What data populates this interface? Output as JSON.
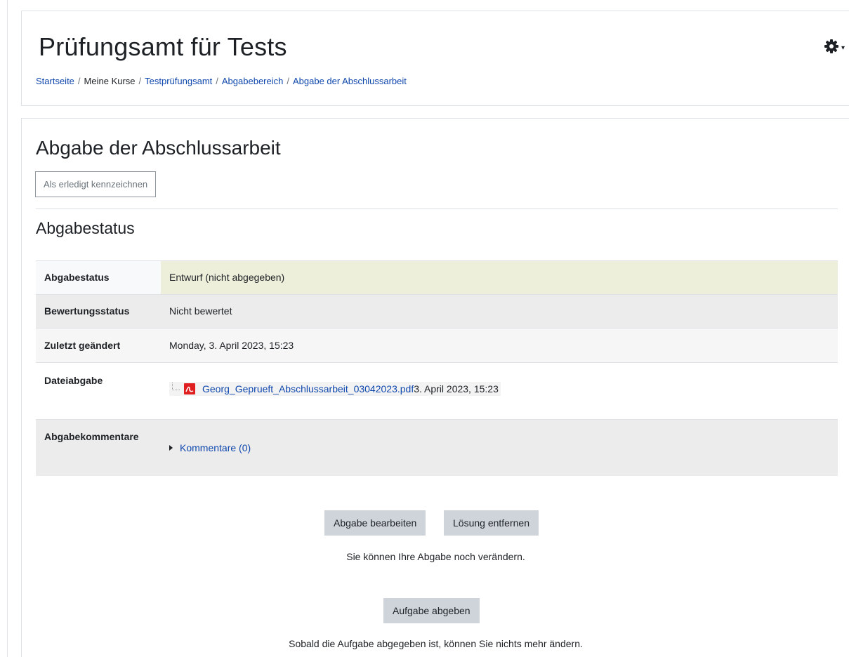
{
  "header": {
    "title": "Prüfungsamt für Tests",
    "breadcrumb": [
      "Startseite",
      "Meine Kurse",
      "Testprüfungsamt",
      "Abgabebereich",
      "Abgabe der Abschlussarbeit"
    ]
  },
  "assignment": {
    "title": "Abgabe der Abschlussarbeit",
    "mark_done_label": "Als erledigt kennzeichnen",
    "section_title": "Abgabestatus"
  },
  "status_table": {
    "submission_status_label": "Abgabestatus",
    "submission_status_value": "Entwurf (nicht abgegeben)",
    "grading_status_label": "Bewertungsstatus",
    "grading_status_value": "Nicht bewertet",
    "last_modified_label": "Zuletzt geändert",
    "last_modified_value": "Monday, 3. April 2023, 15:23",
    "file_submission_label": "Dateiabgabe",
    "file_name": "Georg_Geprueft_Abschlussarbeit_03042023.pdf",
    "file_date": "3. April 2023, 15:23",
    "comments_label": "Abgabekommentare",
    "comments_toggle": "Kommentare (0)"
  },
  "actions": {
    "edit_label": "Abgabe bearbeiten",
    "remove_label": "Lösung entfernen",
    "edit_note": "Sie können Ihre Abgabe noch verändern.",
    "submit_label": "Aufgabe abgeben",
    "submit_note": "Sobald die Aufgabe abgegeben ist, können Sie nichts mehr ändern."
  },
  "colors": {
    "link": "#0f47ad",
    "status_highlight": "#eeefdb",
    "button_gray": "#ced4da"
  },
  "icons": [
    "gear-icon",
    "pdf-file-icon",
    "expand-triangle-icon"
  ]
}
